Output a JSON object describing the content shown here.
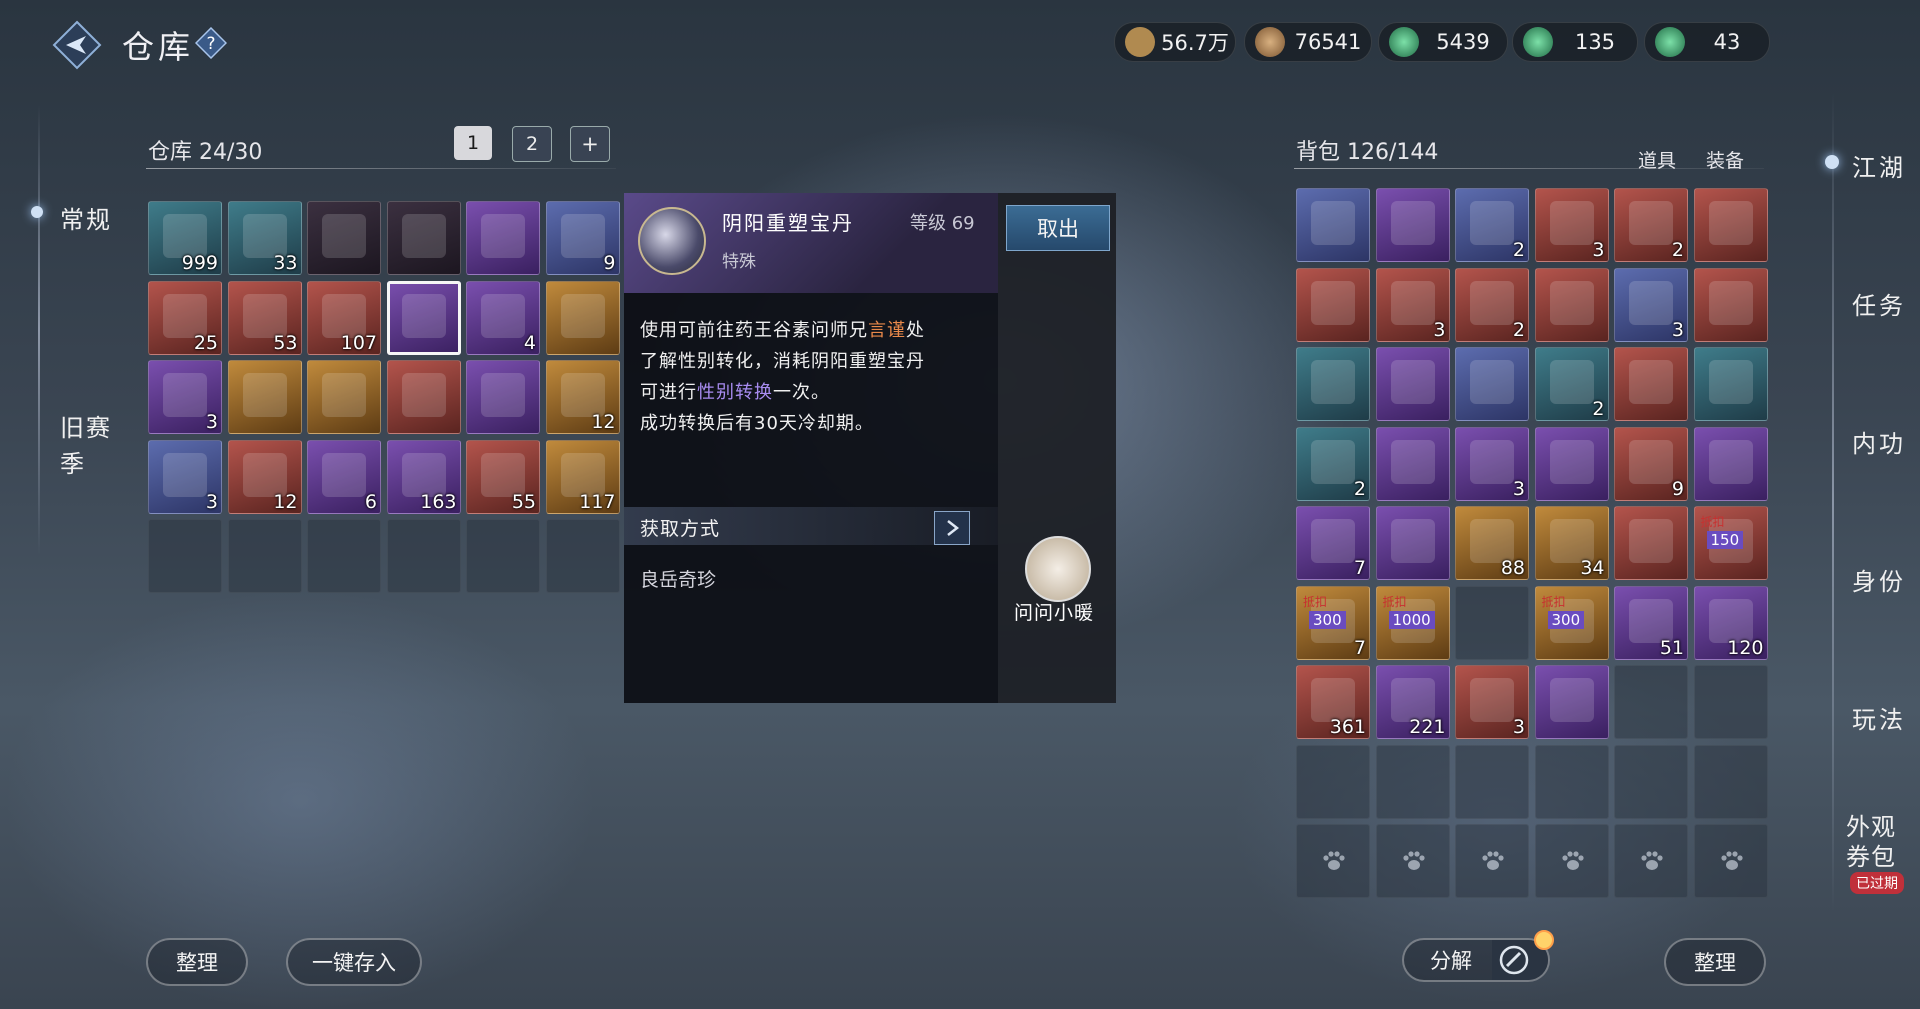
{
  "header": {
    "title": "仓库",
    "help_icon": "question-icon"
  },
  "currencies": [
    {
      "icon": "scroll-currency-icon",
      "value": "56.7万"
    },
    {
      "icon": "copper-coin-icon",
      "value": "76541"
    },
    {
      "icon": "jade-coin-icon",
      "value": "5439"
    },
    {
      "icon": "jade-coin-icon",
      "value": "135"
    },
    {
      "icon": "jade-coin-icon",
      "value": "43"
    }
  ],
  "left_nav": {
    "items": [
      "常规",
      "旧赛季"
    ]
  },
  "warehouse": {
    "title": "仓库",
    "count": "24/30",
    "page_tabs": [
      "1",
      "2",
      "+"
    ],
    "counts": [
      "999",
      "33",
      "",
      "",
      "",
      "9",
      "25",
      "53",
      "107",
      "",
      "4",
      "",
      "3",
      "",
      "",
      "",
      "",
      "12",
      "3",
      "12",
      "6",
      "163",
      "55",
      "117"
    ],
    "sort_button": "整理",
    "deposit_button": "一键存入"
  },
  "tooltip": {
    "item_name": "阴阳重塑宝丹",
    "level_label": "等级 69",
    "category": "特殊",
    "desc_line1_a": "使用可前往药王谷素问师兄",
    "desc_line1_b": "言谨",
    "desc_line1_c": "处",
    "desc_line2": "了解性别转化，消耗阴阳重塑宝丹",
    "desc_line3_a": "可进行",
    "desc_line3_b": "性别转换",
    "desc_line3_c": "一次。",
    "desc_line4": "成功转换后有30天冷却期。",
    "source_header": "获取方式",
    "source_value": "良岳奇珍",
    "take_out_button": "取出",
    "assistant_label": "问问小暖",
    "highlight_color": "#e8884a",
    "link_color": "#a88cf0"
  },
  "bag": {
    "title": "背包",
    "count": "126/144",
    "tab_items": "道具",
    "tab_equip": "装备",
    "counts": [
      "",
      "",
      "2",
      "3",
      "2",
      "",
      "",
      "3",
      "2",
      "",
      "3",
      "",
      "",
      "",
      "",
      "2",
      "",
      "",
      "2",
      "",
      "3",
      "",
      "9",
      "",
      "7",
      "",
      "88",
      "34",
      "",
      "",
      "7",
      "",
      "",
      "",
      "51",
      "120",
      "361",
      "221",
      "3",
      "",
      "",
      ""
    ],
    "coupon_labels": [
      "300",
      "1000",
      "300",
      "150"
    ],
    "coupon_tag": "抵扣",
    "decompose_button": "分解",
    "sort_button": "整理"
  },
  "right_nav": {
    "items": [
      "江湖",
      "任务",
      "内功",
      "身份",
      "玩法",
      "外观券包"
    ],
    "expired_badge": "已过期"
  }
}
